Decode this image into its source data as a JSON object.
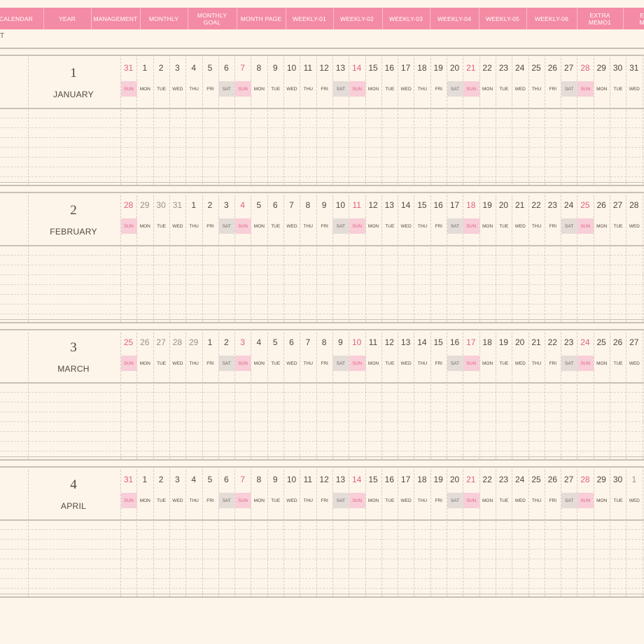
{
  "nav": {
    "items": [
      "CALENDAR",
      "YEAR",
      "MANAGEMENT",
      "MONTHLY",
      "MONTHLY\nGOAL",
      "MONTH PAGE",
      "WEEKLY-01",
      "WEEKLY-02",
      "WEEKLY-03",
      "WEEKLY-04",
      "WEEKLY-05",
      "WEEKLY-06",
      "EXTRA\nMEMO1",
      "EX\nME"
    ]
  },
  "sub_label": "T",
  "weekday_labels": [
    "SUN",
    "MON",
    "TUE",
    "WED",
    "THU",
    "FRI",
    "SAT"
  ],
  "months": [
    {
      "number": "1",
      "name": "JANUARY",
      "dates": [
        "31",
        "1",
        "2",
        "3",
        "4",
        "5",
        "6",
        "7",
        "8",
        "9",
        "10",
        "11",
        "12",
        "13",
        "14",
        "15",
        "16",
        "17",
        "18",
        "19",
        "20",
        "21",
        "22",
        "23",
        "24",
        "25",
        "26",
        "27",
        "28",
        "29",
        "30",
        "31"
      ],
      "prev_month_count": 1,
      "next_month_from": 32
    },
    {
      "number": "2",
      "name": "FEBRUARY",
      "dates": [
        "28",
        "29",
        "30",
        "31",
        "1",
        "2",
        "3",
        "4",
        "5",
        "6",
        "7",
        "8",
        "9",
        "10",
        "11",
        "12",
        "13",
        "14",
        "15",
        "16",
        "17",
        "18",
        "19",
        "20",
        "21",
        "22",
        "23",
        "24",
        "25",
        "26",
        "27",
        "28"
      ],
      "prev_month_count": 4,
      "next_month_from": 32
    },
    {
      "number": "3",
      "name": "MARCH",
      "dates": [
        "25",
        "26",
        "27",
        "28",
        "29",
        "1",
        "2",
        "3",
        "4",
        "5",
        "6",
        "7",
        "8",
        "9",
        "10",
        "11",
        "12",
        "13",
        "14",
        "15",
        "16",
        "17",
        "18",
        "19",
        "20",
        "21",
        "22",
        "23",
        "24",
        "25",
        "26",
        "27"
      ],
      "prev_month_count": 5,
      "next_month_from": 32
    },
    {
      "number": "4",
      "name": "APRIL",
      "dates": [
        "31",
        "1",
        "2",
        "3",
        "4",
        "5",
        "6",
        "7",
        "8",
        "9",
        "10",
        "11",
        "12",
        "13",
        "14",
        "15",
        "16",
        "17",
        "18",
        "19",
        "20",
        "21",
        "22",
        "23",
        "24",
        "25",
        "26",
        "27",
        "28",
        "29",
        "30",
        "1"
      ],
      "prev_month_count": 1,
      "next_month_from": 31
    }
  ],
  "colors": {
    "nav_bg": "#f48ba4",
    "page_bg": "#fdf5ea",
    "sunday": "#e0607e",
    "sunday_bg": "#f8ced8",
    "saturday_bg": "#e4ddd7",
    "text": "#4f4741"
  }
}
